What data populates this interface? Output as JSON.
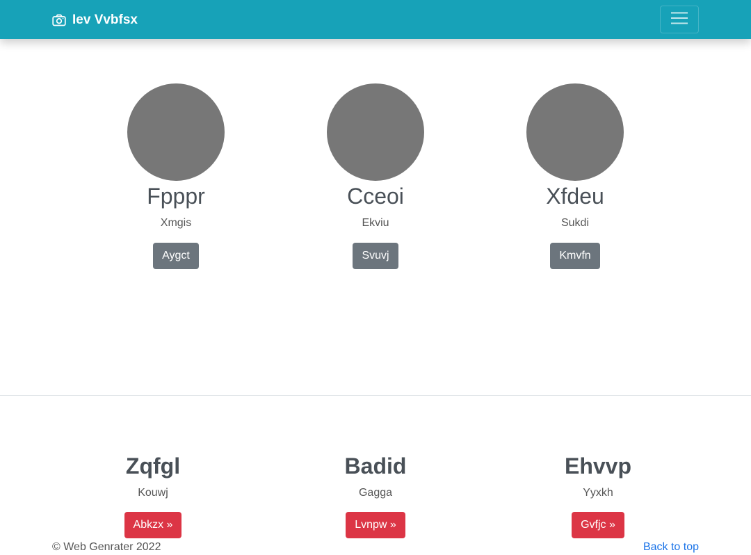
{
  "navbar": {
    "brand_icon": "camera-icon",
    "brand_text": "Iev Vvbfsx",
    "toggler_icon": "hamburger-menu-icon",
    "color": "#17a2b8"
  },
  "team": [
    {
      "name": "Fpppr",
      "role": "Xmgis",
      "button": "Aygct"
    },
    {
      "name": "Cceoi",
      "role": "Ekviu",
      "button": "Svuvj"
    },
    {
      "name": "Xfdeu",
      "role": "Sukdi",
      "button": "Kmvfn"
    }
  ],
  "features": [
    {
      "title": "Zqfgl",
      "text": "Kouwj",
      "button": "Abkzx »"
    },
    {
      "title": "Badid",
      "text": "Gagga",
      "button": "Lvnpw »"
    },
    {
      "title": "Ehvvp",
      "text": "Yyxkh",
      "button": "Gvfjc »"
    }
  ],
  "footer": {
    "copyright": "© Web Genrater 2022",
    "back_to_top": "Back to top"
  },
  "colors": {
    "secondary_button": "#6c757d",
    "danger_button": "#dc3545",
    "avatar_placeholder": "#777777",
    "link": "#1a73e8"
  }
}
